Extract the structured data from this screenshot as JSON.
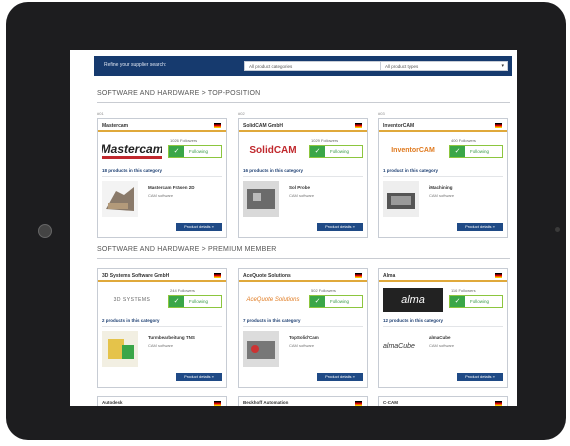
{
  "search": {
    "label": "Refine your supplier search:",
    "category_selected": "All product categories",
    "type_selected": "All product types"
  },
  "sections": [
    {
      "title": "SOFTWARE AND HARDWARE > TOP-POSITION",
      "cards": [
        {
          "rank": "#01",
          "company": "Mastercam",
          "logo_text": "Mastercam",
          "followers": "1026 Followers",
          "follow_label": "Following",
          "count": "18 products in this category",
          "product": "Mastercam Fräsen 2D",
          "product_type": "CAM software",
          "details": "Product details »"
        },
        {
          "rank": "#02",
          "company": "SolidCAM GmbH",
          "logo_text": "SolidCAM",
          "followers": "1029 Followers",
          "follow_label": "Following",
          "count": "16 products in this category",
          "product": "Sol Probe",
          "product_type": "CAM software",
          "details": "Product details »"
        },
        {
          "rank": "#03",
          "company": "InventorCAM",
          "logo_text": "InventorCAM",
          "followers": "400 Followers",
          "follow_label": "Following",
          "count": "1 product in this category",
          "product": "iMachining",
          "product_type": "CAM software",
          "details": "Product details »"
        }
      ]
    },
    {
      "title": "SOFTWARE AND HARDWARE > PREMIUM MEMBER",
      "cards": [
        {
          "company": "3D Systems Software GmbH",
          "logo_text": "3D SYSTEMS",
          "followers": "244 Followers",
          "follow_label": "Following",
          "count": "2 products in this category",
          "product": "Turmbearbeitung TNS",
          "product_type": "CAM software",
          "details": "Product details »"
        },
        {
          "company": "AceQuote Solutions",
          "logo_text": "AceQuote Solutions",
          "followers": "502 Followers",
          "follow_label": "Following",
          "count": "7 products in this category",
          "product": "TopSolid'Cam",
          "product_type": "CAM software",
          "details": "Product details »"
        },
        {
          "company": "Alma",
          "logo_text": "alma",
          "followers": "116 Followers",
          "follow_label": "Following",
          "count": "12 products in this category",
          "product": "almaCube",
          "product_type": "CAM software",
          "details": "Product details »"
        }
      ]
    }
  ],
  "bottom_cards": [
    "Autodesk",
    "Beckhoff Automation",
    "C-CAM"
  ],
  "colors": {
    "nav": "#163a6e",
    "accent": "#e0a93b",
    "follow": "#3aa648",
    "button": "#1f4a86"
  }
}
